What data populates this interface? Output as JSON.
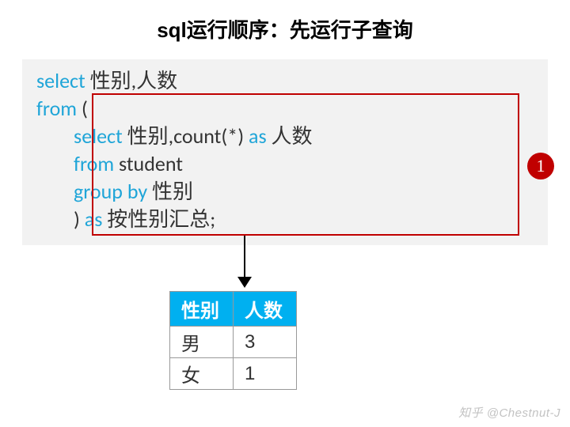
{
  "title": "sql运行顺序：先运行子查询",
  "code": {
    "line1_kw1": "select",
    "line1_txt1": " 性别,人数",
    "line2_kw1": "from",
    "line2_txt1": " (",
    "line3_indent": "        ",
    "line3_kw1": "select",
    "line3_txt1": " 性别,count(*) ",
    "line3_kw2": "as",
    "line3_txt2": " 人数",
    "line4_indent": "        ",
    "line4_kw1": "from",
    "line4_txt1": " student",
    "line5_indent": "        ",
    "line5_kw1": "group by",
    "line5_txt1": " 性别",
    "line6_indent": "        ",
    "line6_txt1": ") ",
    "line6_kw1": "as",
    "line6_txt2": " 按性别汇总;"
  },
  "badge": "1",
  "table": {
    "headers": [
      "性别",
      "人数"
    ],
    "rows": [
      [
        "男",
        "3"
      ],
      [
        "女",
        "1"
      ]
    ]
  },
  "watermark": "知乎 @Chestnut-J"
}
